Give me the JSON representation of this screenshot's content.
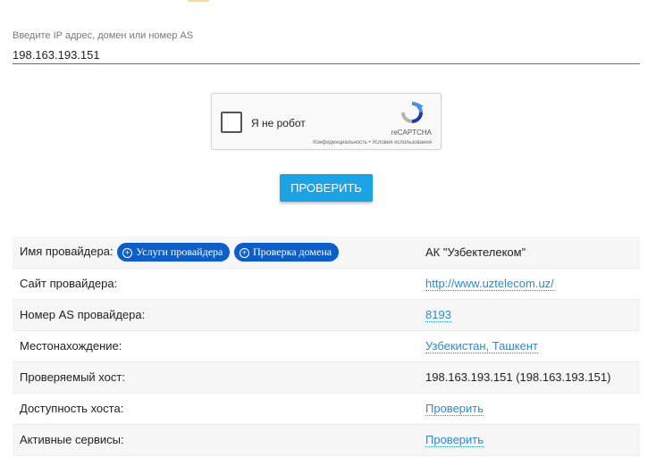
{
  "form": {
    "label": "Введите IP адрес, домен или номер AS",
    "value": "198.163.193.151",
    "submit_label": "ПРОВЕРИТЬ"
  },
  "captcha": {
    "label": "Я не робот",
    "brand": "reCAPTCHA",
    "legal": "Конфиденциальность • Условия использования"
  },
  "results": {
    "provider_name_label": "Имя провайдера:",
    "provider_services_button": "Услуги провайдера",
    "domain_check_button": "Проверка домена",
    "provider_name_value": "АК \"Узбектелеком\"",
    "site_label": "Сайт провайдера:",
    "site_value": "http://www.uztelecom.uz/",
    "as_label": "Номер AS провайдера:",
    "as_value": "8193",
    "location_label": "Местонахождение:",
    "location_value": "Узбекистан, Ташкент",
    "host_label": "Проверяемый хост:",
    "host_value": "198.163.193.151 (198.163.193.151)",
    "availability_label": "Доступность хоста:",
    "availability_value": "Проверить",
    "services_label": "Активные сервисы:",
    "services_value": "Проверить"
  }
}
